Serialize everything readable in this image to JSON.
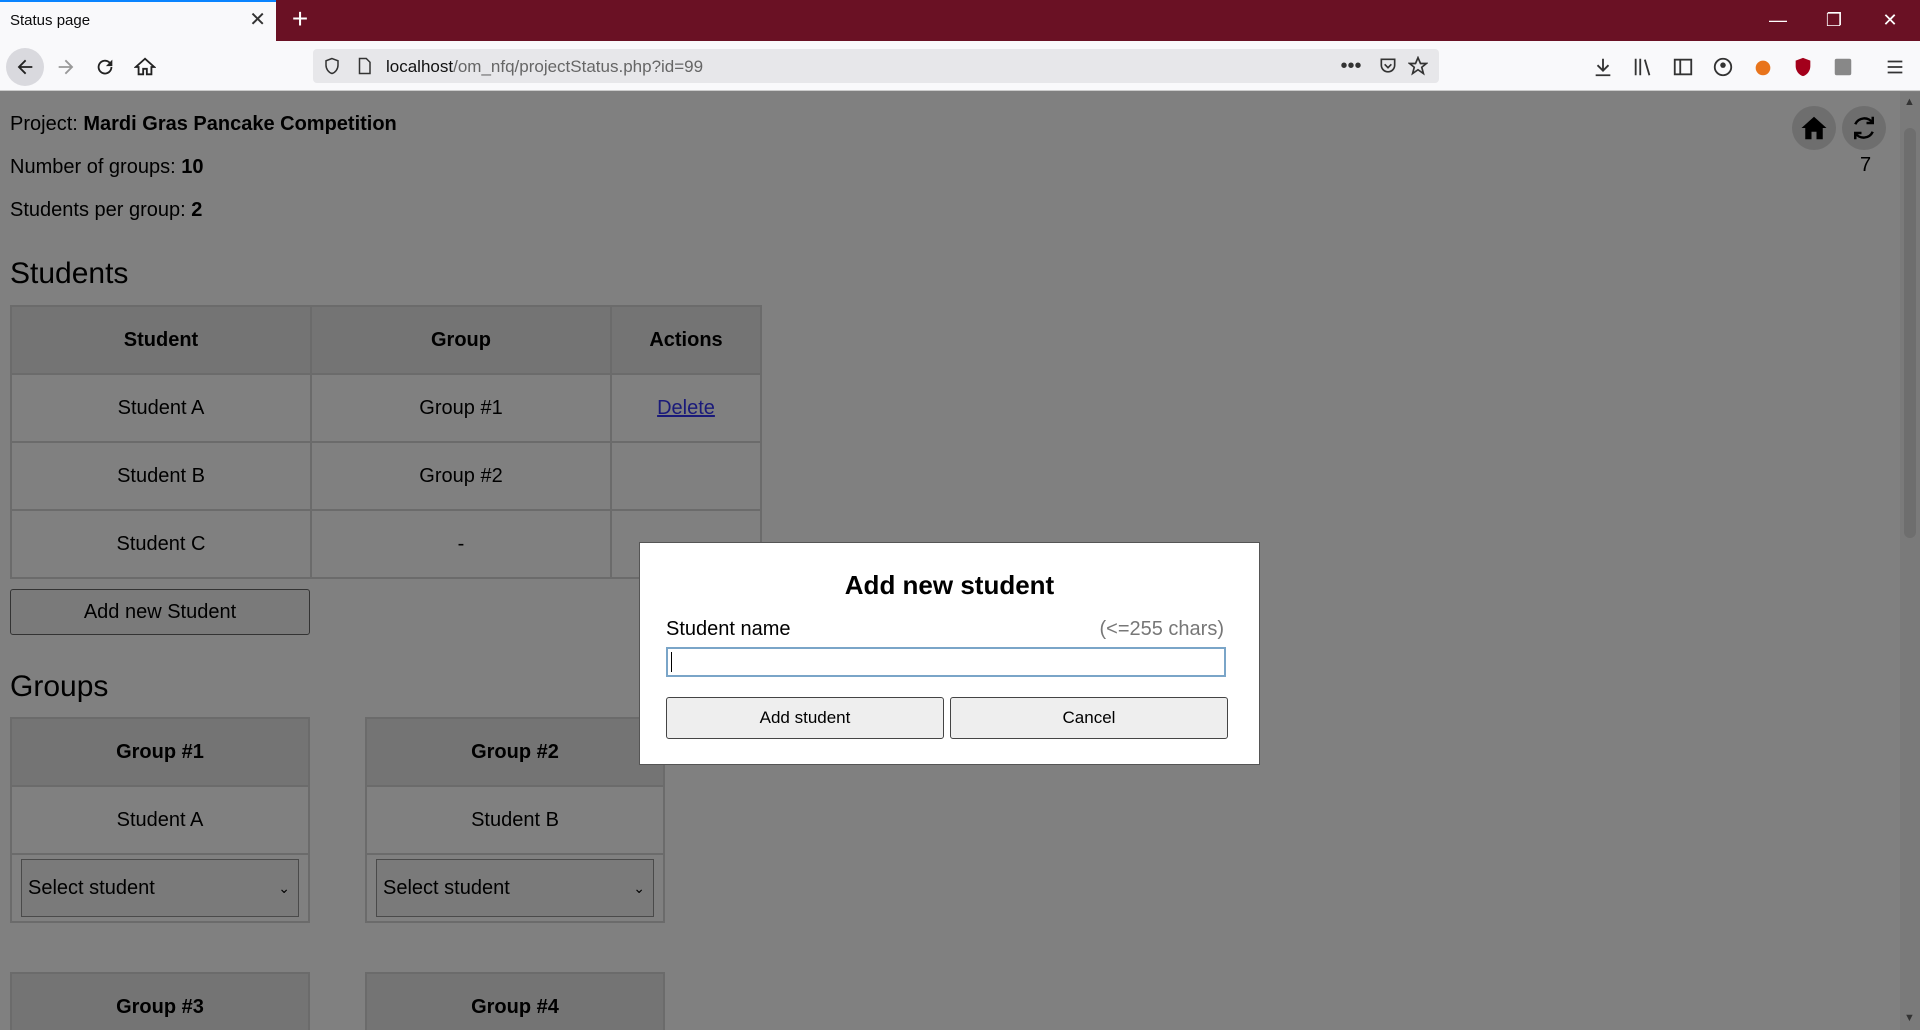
{
  "browser": {
    "tab_title": "Status page",
    "url_host": "localhost",
    "url_path": "/om_nfq/projectStatus.php?id=99"
  },
  "project": {
    "project_label": "Project: ",
    "project_name": "Mardi Gras Pancake Competition",
    "groups_label": "Number of groups: ",
    "groups_count": "10",
    "per_group_label": "Students per group: ",
    "per_group_count": "2",
    "counter": "7"
  },
  "students": {
    "heading": "Students",
    "columns": [
      "Student",
      "Group",
      "Actions"
    ],
    "rows": [
      {
        "student": "Student A",
        "group": "Group #1",
        "action": "Delete"
      },
      {
        "student": "Student B",
        "group": "Group #2",
        "action": ""
      },
      {
        "student": "Student C",
        "group": "-",
        "action": ""
      }
    ],
    "add_button": "Add new Student"
  },
  "groups": {
    "heading": "Groups",
    "items": [
      {
        "name": "Group #1",
        "member": "Student A",
        "select": "Select student"
      },
      {
        "name": "Group #2",
        "member": "Student B",
        "select": "Select student"
      },
      {
        "name": "Group #3"
      },
      {
        "name": "Group #4"
      }
    ]
  },
  "modal": {
    "title": "Add new student",
    "field_label": "Student name",
    "field_hint": "(<=255 chars)",
    "field_value": "",
    "submit": "Add student",
    "cancel": "Cancel"
  },
  "icons": {
    "home": "home-icon",
    "refresh": "refresh-icon"
  }
}
